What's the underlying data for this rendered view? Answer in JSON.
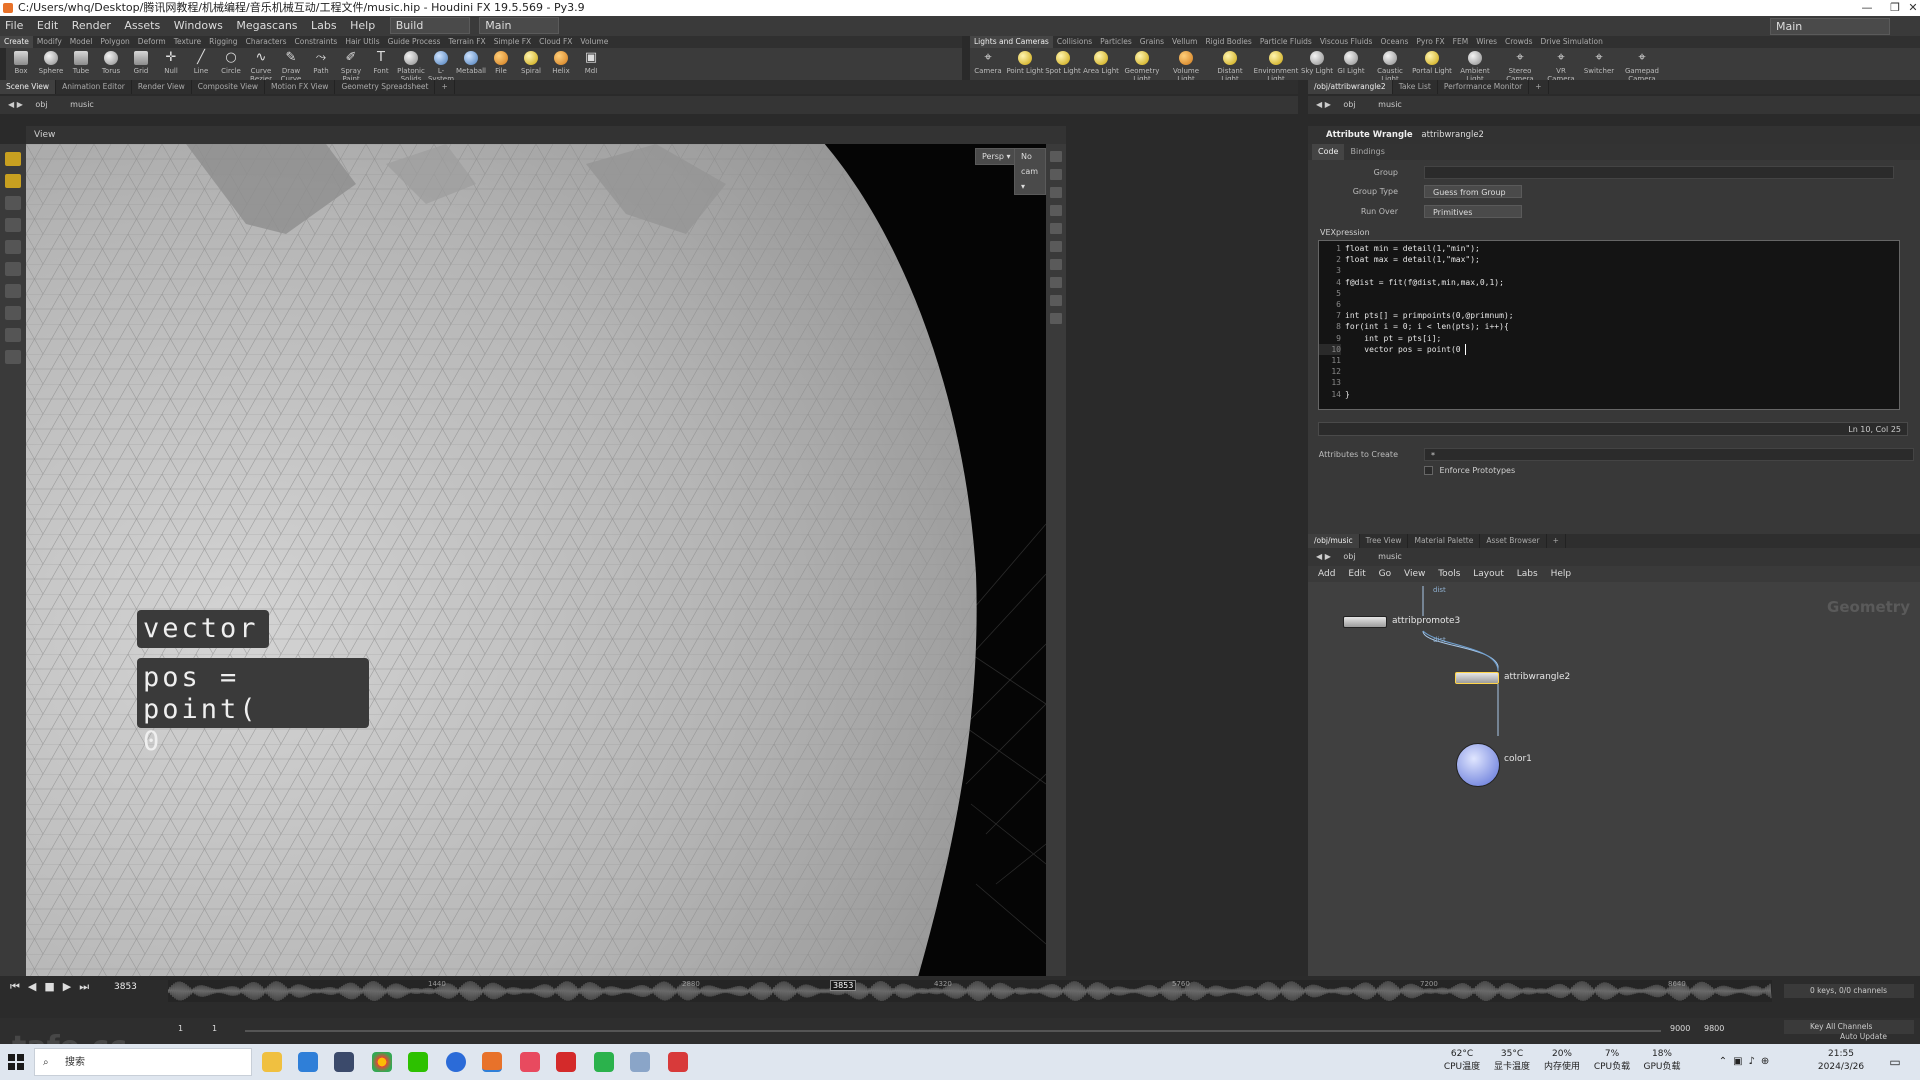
{
  "window": {
    "title": "C:/Users/whq/Desktop/腾讯网教程/机械编程/音乐机械互动/工程文件/music.hip - Houdini FX 19.5.569 - Py3.9"
  },
  "menubar": {
    "items": [
      "File",
      "Edit",
      "Render",
      "Assets",
      "Windows",
      "Megascans",
      "Labs",
      "Help"
    ],
    "desktop": "Build",
    "network": "Main",
    "right_desktop": "Main"
  },
  "shelf": {
    "left_tabs": [
      "Create",
      "Modify",
      "Model",
      "Polygon",
      "Deform",
      "Texture",
      "Rigging",
      "Characters",
      "Constraints",
      "Hair Utils",
      "Guide Process",
      "Terrain FX",
      "Simple FX",
      "Cloud FX",
      "Volume"
    ],
    "right_tabs": [
      "Lights and Cameras",
      "Collisions",
      "Particles",
      "Grains",
      "Vellum",
      "Rigid Bodies",
      "Particle Fluids",
      "Viscous Fluids",
      "Oceans",
      "Pyro FX",
      "FEM",
      "Wires",
      "Crowds",
      "Drive Simulation"
    ],
    "left_tools": [
      "Box",
      "Sphere",
      "Tube",
      "Torus",
      "Grid",
      "Null",
      "Line",
      "Circle",
      "Curve Bezier",
      "Draw Curve",
      "Path",
      "Spray Paint",
      "Font",
      "Platonic Solids",
      "L-System",
      "Metaball",
      "File",
      "Spiral",
      "Helix",
      "MdI"
    ],
    "right_tools": [
      "Camera",
      "Point Light",
      "Spot Light",
      "Area Light",
      "Geometry Light",
      "Volume Light",
      "Distant Light",
      "Environment Light",
      "Sky Light",
      "GI Light",
      "Caustic Light",
      "Portal Light",
      "Ambient Light",
      "Stereo Camera",
      "VR Camera",
      "Switcher",
      "Gamepad Camera"
    ]
  },
  "left_tabs": [
    "Scene View",
    "Animation Editor",
    "Render View",
    "Composite View",
    "Motion FX View",
    "Geometry Spreadsheet"
  ],
  "right_tabs": [
    "/obj/attribwrangle2",
    "Take List",
    "Performance Monitor"
  ],
  "path": {
    "obj": "obj",
    "node": "music"
  },
  "viewport": {
    "title": "View",
    "persp": "Persp ▾",
    "cam": "No cam ▾",
    "overlay_line1": "vector",
    "overlay_line2": "pos = point(",
    "overlay_line3": "0"
  },
  "params": {
    "node_type": "Attribute Wrangle",
    "node_name": "attribwrangle2",
    "tabs": [
      "Code",
      "Bindings"
    ],
    "group_label": "Group",
    "group_type_label": "Group Type",
    "group_type_value": "Guess from Group",
    "run_over_label": "Run Over",
    "run_over_value": "Primitives",
    "vex_label": "VEXpression",
    "code_lines": [
      "float min = detail(1,\"min\");",
      "float max = detail(1,\"max\");",
      "",
      "f@dist = fit(f@dist,min,max,0,1);",
      "",
      "",
      "int pts[] = primpoints(0,@primnum);",
      "for(int i = 0; i < len(pts); i++){",
      "    int pt = pts[i];",
      "    vector pos = point(0",
      "",
      "",
      "",
      "}"
    ],
    "line_numbers": [
      "1",
      "2",
      "3",
      "4",
      "5",
      "6",
      "7",
      "8",
      "9",
      "10",
      "11",
      "12",
      "13",
      "14"
    ],
    "cursor_pos": "Ln 10, Col 25",
    "attrs_label": "Attributes to Create",
    "attrs_value": "*",
    "enforce_label": "Enforce Prototypes"
  },
  "network": {
    "tabs": [
      "/obj/music",
      "Tree View",
      "Material Palette",
      "Asset Browser"
    ],
    "menu": [
      "Add",
      "Edit",
      "Go",
      "View",
      "Tools",
      "Layout",
      "Labs",
      "Help"
    ],
    "context_label": "Geometry",
    "nodes": [
      {
        "name": "attribpromote3"
      },
      {
        "name": "attribwrangle2"
      },
      {
        "name": "color1"
      }
    ],
    "wire_label_top": "dist",
    "wire_label_mid": "dist"
  },
  "timeline": {
    "frame": "3853",
    "marker": "3853",
    "ticks": [
      "1440",
      "2880",
      "4320",
      "5760",
      "7200",
      "8640"
    ],
    "start1": "1",
    "start2": "1",
    "end1": "9000",
    "end2": "9800",
    "keys": "0 keys, 0/0 channels",
    "key_all": "Key All Channels",
    "auto_update": "Auto Update"
  },
  "taskbar": {
    "search_placeholder": "搜索",
    "stats": [
      {
        "value": "62°C",
        "label": "CPU温度"
      },
      {
        "value": "35°C",
        "label": "显卡温度"
      },
      {
        "value": "20%",
        "label": "内存使用"
      },
      {
        "value": "7%",
        "label": "CPU负载"
      },
      {
        "value": "18%",
        "label": "GPU负载"
      }
    ],
    "time": "21:55",
    "date": "2024/3/26",
    "watermark": "tafe.cc"
  },
  "colors": {
    "accent": "#e8722a",
    "code_bg": "#141414",
    "node_selected": "#ffd54a",
    "color_node": "#5a6fd6"
  }
}
